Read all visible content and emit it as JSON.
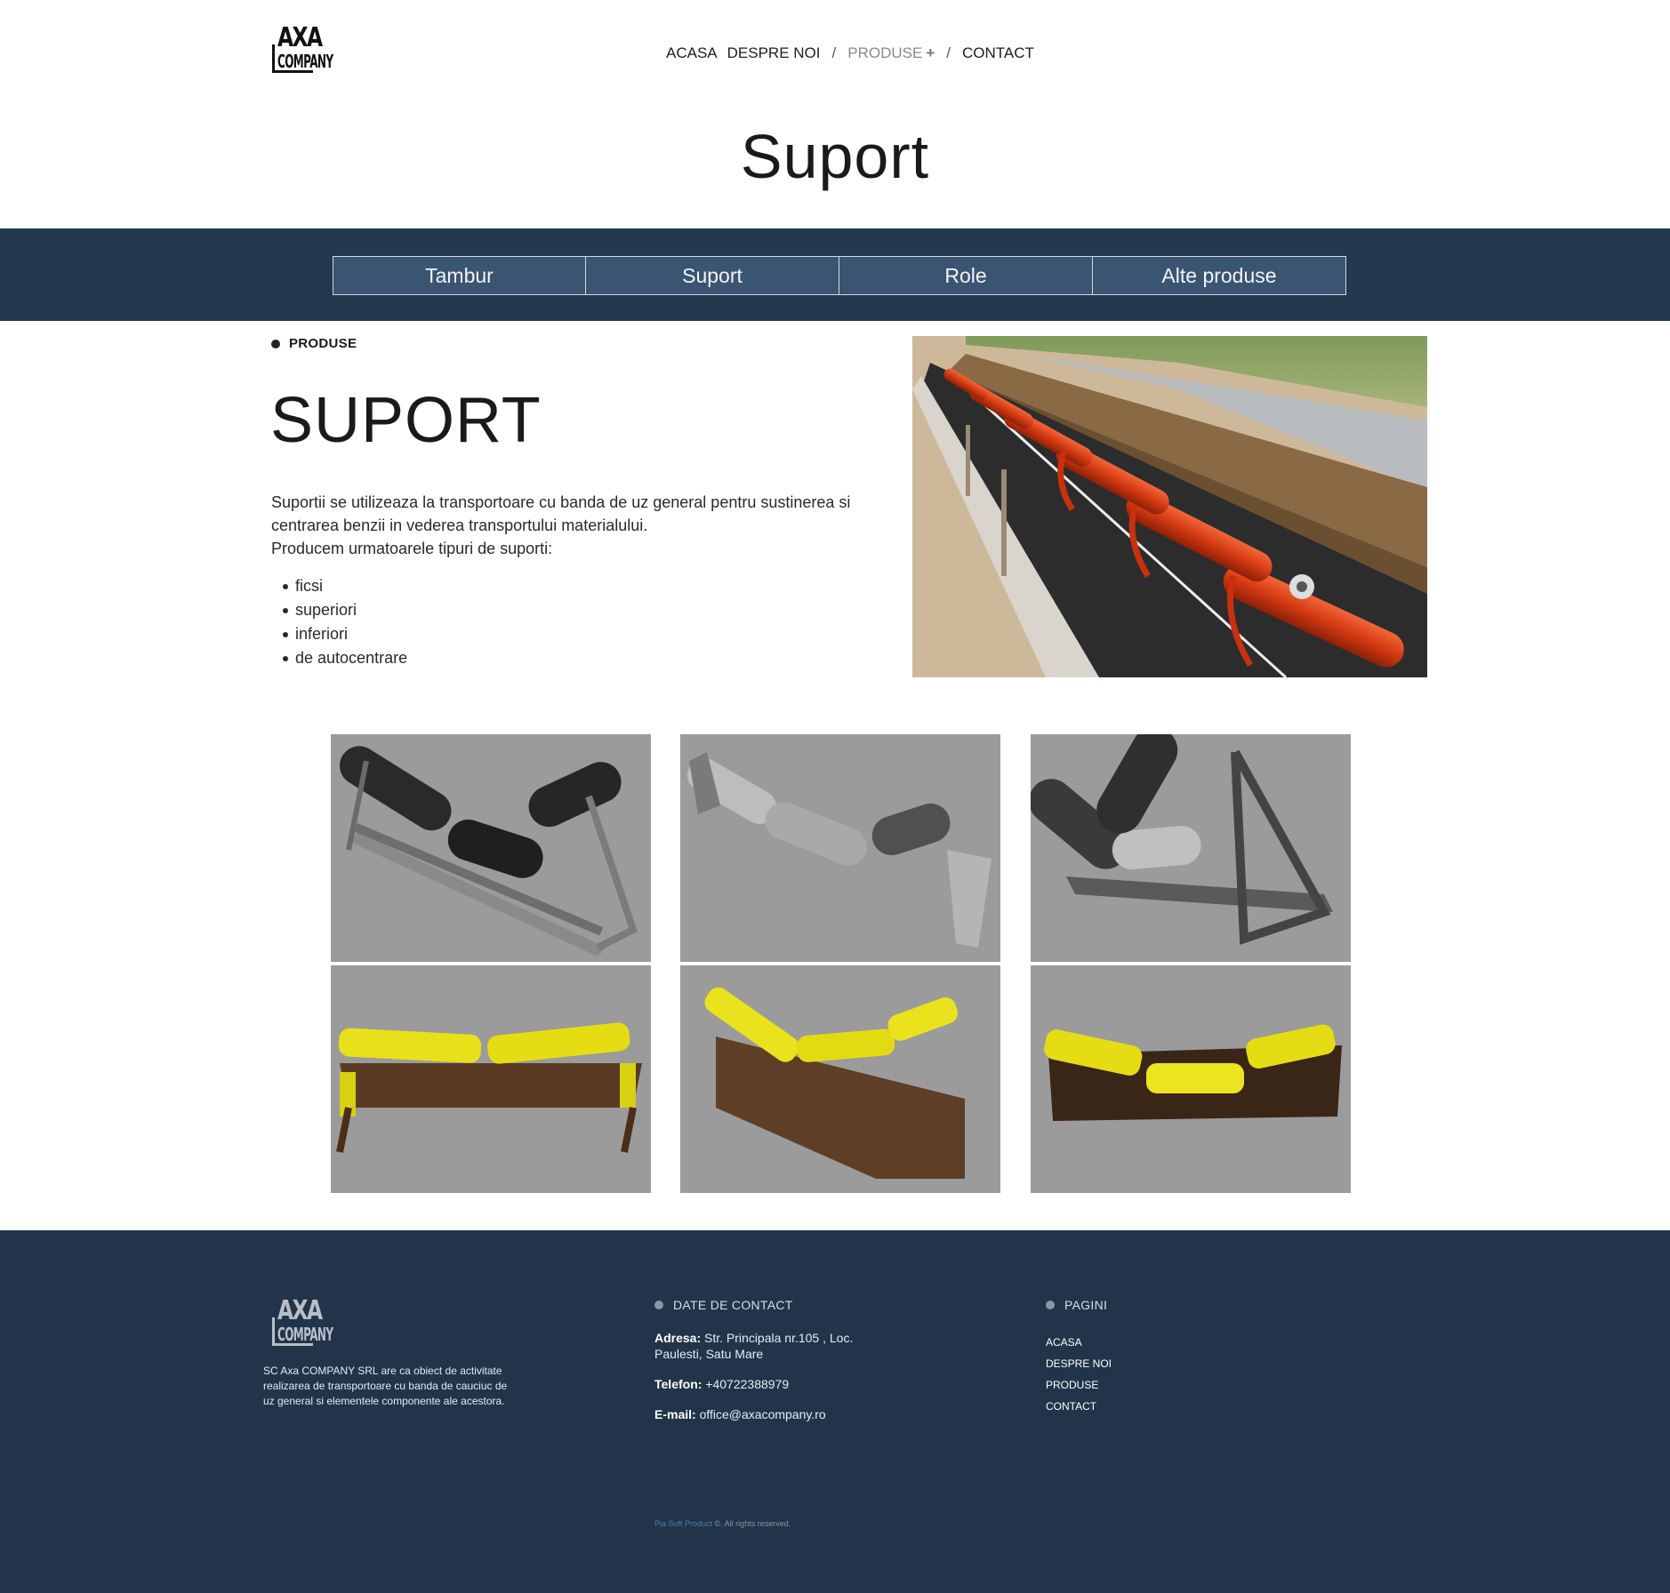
{
  "header": {
    "logo_top": "AXA",
    "logo_bottom": "COMPANY",
    "nav": {
      "acasa": "ACASA",
      "despre": "DESPRE NOI",
      "sep1": "/",
      "produse": "PRODUSE",
      "plus": "+",
      "sep2": "/",
      "contact": "CONTACT"
    },
    "page_title": "Suport"
  },
  "tabs": [
    "Tambur",
    "Suport",
    "Role",
    "Alte produse"
  ],
  "main": {
    "crumb": "PRODUSE",
    "heading": "SUPORT",
    "desc_line1": "Suportii se utilizeaza la transportoare cu banda de uz general pentru sustinerea si centrarea benzii in vederea transportului materialului.",
    "desc_line2": "Producem urmatoarele tipuri de suporti:",
    "bullets": [
      "ficsi",
      "superiori",
      "inferiori",
      "de autocentrare"
    ]
  },
  "gallery": {
    "colors": {
      "gray_bg": "#9b9b9b",
      "dark_roller": "#2a2a2a",
      "steel": "#b8b8b8",
      "yellow": "#e8e01a",
      "brown": "#5a3a22",
      "orange": "#d43a12"
    }
  },
  "footer": {
    "logo_top": "AXA",
    "logo_bottom": "COMPANY",
    "about": "SC Axa COMPANY SRL are ca obiect de activitate realizarea de transportoare cu banda de cauciuc de uz general si elementele componente ale acestora.",
    "contact_heading": "DATE DE CONTACT",
    "address_label": "Adresa:",
    "address_value": "Str. Principala nr.105 , Loc. Paulesti, Satu Mare",
    "phone_label": "Telefon:",
    "phone_value": "+40722388979",
    "email_label": "E-mail:",
    "email_value": "office@axacompany.ro",
    "pages_heading": "PAGINI",
    "pages": [
      "ACASA",
      "DESPRE NOI",
      "PRODUSE",
      "CONTACT"
    ],
    "copy_brand": "Pia Soft Product",
    "copy_rest": " ©. All rights reserved."
  },
  "colors": {
    "band": "#243850",
    "tab_bg": "#3b5472",
    "footer": "#223449"
  }
}
